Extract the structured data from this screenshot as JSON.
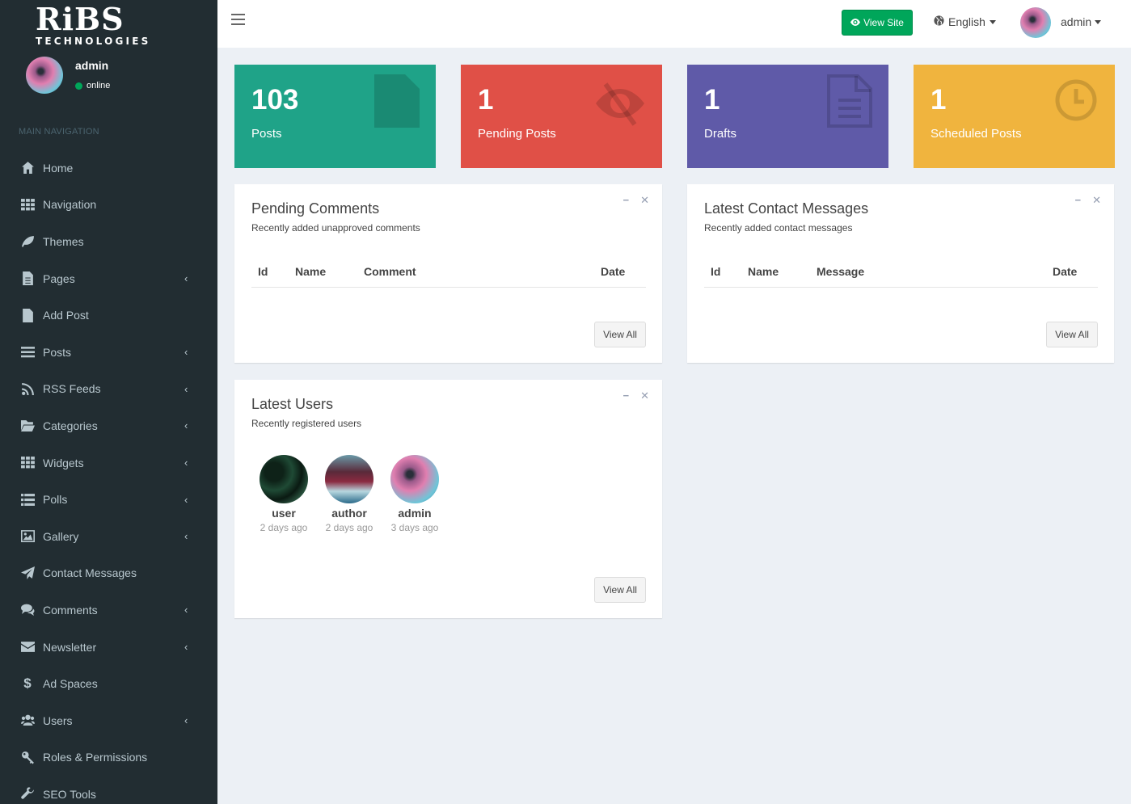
{
  "brand": {
    "main": "RiBS",
    "sub": "TECHNOLOGIES"
  },
  "user_panel": {
    "name": "admin",
    "status": "online"
  },
  "nav": {
    "header": "MAIN NAVIGATION",
    "items": [
      {
        "label": "Home",
        "icon": "home-icon",
        "chevron": false
      },
      {
        "label": "Navigation",
        "icon": "grid-icon",
        "chevron": false
      },
      {
        "label": "Themes",
        "icon": "leaf-icon",
        "chevron": false
      },
      {
        "label": "Pages",
        "icon": "file-text-icon",
        "chevron": true
      },
      {
        "label": "Add Post",
        "icon": "file-icon",
        "chevron": false
      },
      {
        "label": "Posts",
        "icon": "bars-icon",
        "chevron": true
      },
      {
        "label": "RSS Feeds",
        "icon": "rss-icon",
        "chevron": true
      },
      {
        "label": "Categories",
        "icon": "folder-open-icon",
        "chevron": true
      },
      {
        "label": "Widgets",
        "icon": "grid-icon",
        "chevron": true
      },
      {
        "label": "Polls",
        "icon": "list-icon",
        "chevron": true
      },
      {
        "label": "Gallery",
        "icon": "image-icon",
        "chevron": true
      },
      {
        "label": "Contact Messages",
        "icon": "paper-plane-icon",
        "chevron": false
      },
      {
        "label": "Comments",
        "icon": "comments-icon",
        "chevron": true
      },
      {
        "label": "Newsletter",
        "icon": "envelope-icon",
        "chevron": true
      },
      {
        "label": "Ad Spaces",
        "icon": "dollar-icon",
        "chevron": false
      },
      {
        "label": "Users",
        "icon": "users-icon",
        "chevron": true
      },
      {
        "label": "Roles & Permissions",
        "icon": "key-icon",
        "chevron": false
      },
      {
        "label": "SEO Tools",
        "icon": "wrench-icon",
        "chevron": false
      }
    ]
  },
  "topbar": {
    "view_site": "View Site",
    "language": "English",
    "user": "admin"
  },
  "stats": [
    {
      "value": "103",
      "label": "Posts",
      "color": "#1fa388",
      "icon": "file-icon"
    },
    {
      "value": "1",
      "label": "Pending Posts",
      "color": "#e05047",
      "icon": "eye-slash-icon"
    },
    {
      "value": "1",
      "label": "Drafts",
      "color": "#5f5aa8",
      "icon": "file-text-outline-icon"
    },
    {
      "value": "1",
      "label": "Scheduled Posts",
      "color": "#f0b43e",
      "icon": "clock-icon"
    }
  ],
  "pending_comments": {
    "title": "Pending Comments",
    "subtitle": "Recently added unapproved comments",
    "columns": [
      "Id",
      "Name",
      "Comment",
      "Date"
    ],
    "view_all": "View All"
  },
  "contact_messages": {
    "title": "Latest Contact Messages",
    "subtitle": "Recently added contact messages",
    "columns": [
      "Id",
      "Name",
      "Message",
      "Date"
    ],
    "view_all": "View All"
  },
  "latest_users": {
    "title": "Latest Users",
    "subtitle": "Recently registered users",
    "users": [
      {
        "name": "user",
        "date": "2 days ago"
      },
      {
        "name": "author",
        "date": "2 days ago"
      },
      {
        "name": "admin",
        "date": "3 days ago"
      }
    ],
    "view_all": "View All"
  }
}
